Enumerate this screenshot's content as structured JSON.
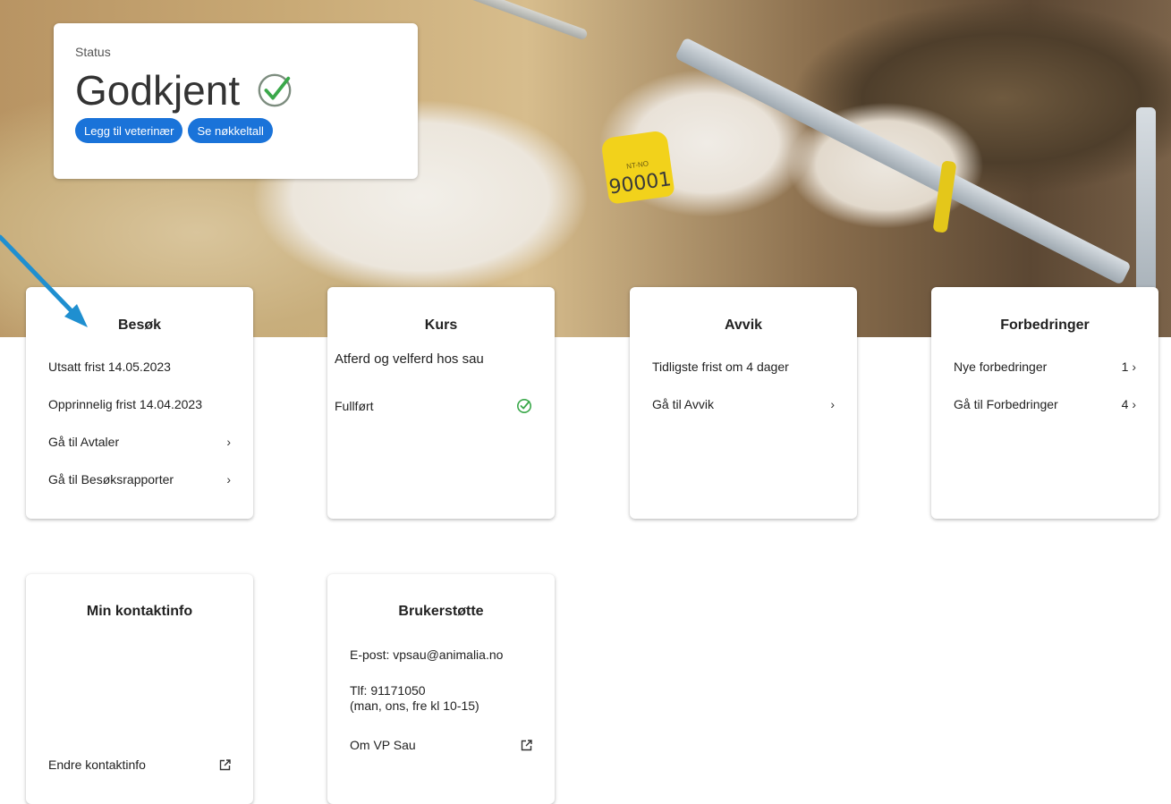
{
  "status": {
    "label": "Status",
    "value": "Godkjent",
    "buttons": [
      "Legg til veterinær",
      "Se nøkkeltall"
    ]
  },
  "hero": {
    "ear_tag_small": "NT-NO",
    "ear_tag_number": "90001"
  },
  "cards": {
    "besok": {
      "title": "Besøk",
      "rows": [
        "Utsatt frist 14.05.2023",
        "Opprinnelig frist 14.04.2023",
        "Gå til Avtaler",
        "Gå til Besøksrapporter"
      ]
    },
    "kurs": {
      "title": "Kurs",
      "course": "Atferd og velferd hos sau",
      "status": "Fullført"
    },
    "avvik": {
      "title": "Avvik",
      "rows": [
        "Tidligste frist om 4 dager",
        "Gå til Avvik"
      ]
    },
    "forbedringer": {
      "title": "Forbedringer",
      "rows": [
        {
          "label": "Nye forbedringer",
          "count": "1"
        },
        {
          "label": "Gå til Forbedringer",
          "count": "4"
        }
      ]
    },
    "kontakt": {
      "title": "Min kontaktinfo",
      "link": "Endre kontaktinfo"
    },
    "brukerstotte": {
      "title": "Brukerstøtte",
      "email": "E-post: vpsau@animalia.no",
      "phone": "Tlf: 91171050",
      "hours": "(man, ons, fre kl 10-15)",
      "link": "Om VP Sau"
    }
  },
  "icons": {
    "check": "check-circle-icon",
    "chevron": "chevron-right-icon",
    "external": "external-link-icon",
    "annotation": "arrow-annotation-icon"
  },
  "colors": {
    "accent": "#1a73d9",
    "success": "#3aa84a",
    "arrow": "#1f8fd0"
  }
}
